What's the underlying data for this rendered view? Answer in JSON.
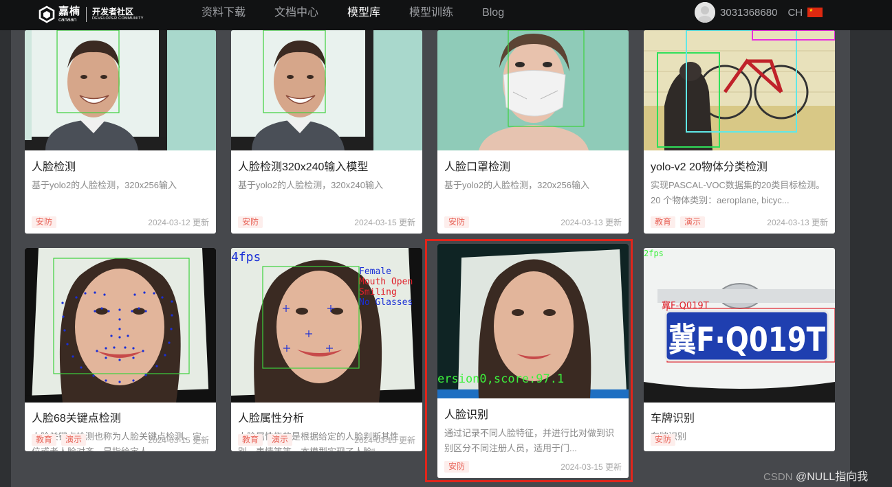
{
  "header": {
    "logo_cn": "嘉楠",
    "logo_en": "canaan",
    "community": "开发者社区",
    "community_en": "DEVELOPER COMMUNITY",
    "nav": [
      {
        "label": "资料下载",
        "active": false
      },
      {
        "label": "文档中心",
        "active": false
      },
      {
        "label": "模型库",
        "active": true
      },
      {
        "label": "模型训练",
        "active": false
      },
      {
        "label": "Blog",
        "active": false
      }
    ],
    "username": "3031368680",
    "lang": "CH"
  },
  "cards": [
    {
      "title": "人脸检测",
      "desc": "基于yolo2的人脸检测，320x256输入",
      "tags": [
        "安防"
      ],
      "date": "2024-03-12 更新"
    },
    {
      "title": "人脸检测320x240输入模型",
      "desc": "基于yolo2的人脸检测，320x240输入",
      "tags": [
        "安防"
      ],
      "date": "2024-03-15 更新"
    },
    {
      "title": "人脸口罩检测",
      "desc": "基于yolo2的人脸检测，320x256输入",
      "tags": [
        "安防"
      ],
      "date": "2024-03-13 更新"
    },
    {
      "title": "yolo-v2 20物体分类检测",
      "desc": "实现PASCAL-VOC数据集的20类目标检测。20 个物体类别：aeroplane, bicyc...",
      "tags": [
        "教育",
        "演示"
      ],
      "date": "2024-03-13 更新"
    },
    {
      "title": "人脸68关键点检测",
      "desc": "人脸关键点检测也称为人脸关键点检测、定位或者人脸对齐，是指给定人...",
      "tags": [
        "教育",
        "演示"
      ],
      "date": "2024-03-15 更新"
    },
    {
      "title": "人脸属性分析",
      "desc": "人脸属性指的是根据给定的人脸判断其性别、表情等等。本模型实现了人脸“...",
      "tags": [
        "教育",
        "演示"
      ],
      "date": "2024-03-15 更新"
    },
    {
      "title": "人脸识别",
      "desc": "通过记录不同人脸特征，并进行比对做到识别区分不同注册人员，适用于门...",
      "tags": [
        "安防"
      ],
      "date": "2024-03-15 更新"
    },
    {
      "title": "车牌识别",
      "desc": "车牌识别",
      "tags": [
        "安防"
      ],
      "date": ""
    }
  ],
  "overlays": {
    "fps_attr": "4fps",
    "fps_plate": "2fps",
    "attr_labels": [
      "Female",
      "Mouth Open",
      "Smiling",
      "No Glasses"
    ],
    "recog_text": "ersion0,score:97.1",
    "plate_small": "冀F-Q019T",
    "plate_big": "冀F·Q019T"
  },
  "watermark": {
    "csdn": "CSDN",
    "author": "@NULL指向我"
  }
}
